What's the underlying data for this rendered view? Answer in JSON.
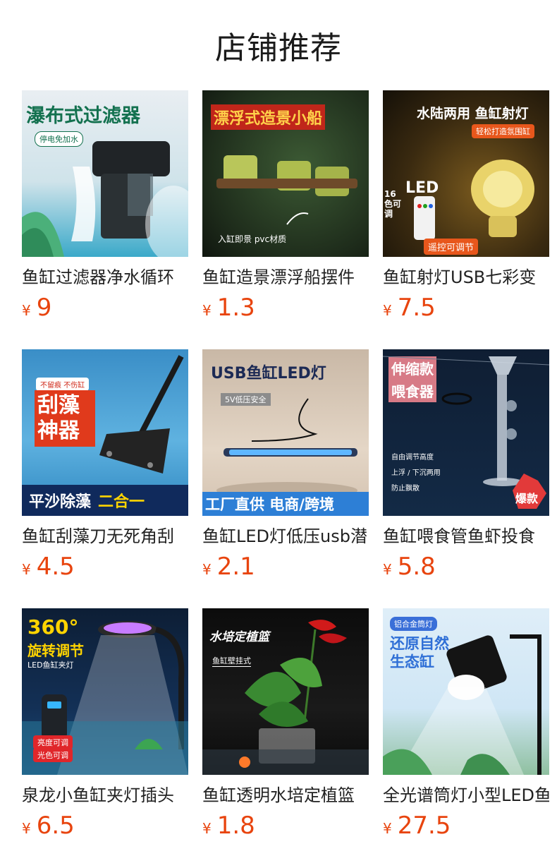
{
  "header": {
    "title": "店铺推荐"
  },
  "currency_symbol": "¥",
  "products": [
    {
      "title": "鱼缸过滤器净水循环",
      "price": "9",
      "thumb_text": {
        "main": "瀑布式过滤器",
        "badge": "停电免加水"
      }
    },
    {
      "title": "鱼缸造景漂浮船摆件",
      "price": "1.3",
      "thumb_text": {
        "main": "漂浮式造景小船",
        "sub": "入缸即景  pvc材质"
      }
    },
    {
      "title": "鱼缸射灯USB七彩变",
      "price": "7.5",
      "thumb_text": {
        "main": "水陆两用 鱼缸射灯",
        "sub": "轻松打造氛围缸",
        "badge1": "16色可调",
        "badge2": "LED",
        "badge3": "遥控可调节"
      }
    },
    {
      "title": "鱼缸刮藻刀无死角刮",
      "price": "4.5",
      "thumb_text": {
        "badge": "不留痕 不伤缸",
        "main": "刮藻神器",
        "bottom1": "平沙除藻",
        "bottom2": "二合一"
      }
    },
    {
      "title": "鱼缸LED灯低压usb潜",
      "price": "2.1",
      "thumb_text": {
        "main": "USB鱼缸LED灯",
        "sub": "5V低压安全",
        "bottom": "工厂直供 电商/跨境"
      }
    },
    {
      "title": "鱼缸喂食管鱼虾投食",
      "price": "5.8",
      "thumb_text": {
        "main1": "伸缩款",
        "main2": "喂食器",
        "f1": "自由调节高度",
        "f2": "上浮 / 下沉两用",
        "f3": "防止飘散",
        "badge": "爆款"
      }
    },
    {
      "title": "泉龙小鱼缸夹灯插头",
      "price": "6.5",
      "thumb_text": {
        "main1": "360°",
        "main2": "旋转调节",
        "sub": "LED鱼缸夹灯",
        "b1": "亮度可调",
        "b2": "光色可调"
      }
    },
    {
      "title": "鱼缸透明水培定植篮",
      "price": "1.8",
      "thumb_text": {
        "main": "水培定植篮",
        "sub": "鱼缸壁挂式"
      }
    },
    {
      "title": "全光谱筒灯小型LED鱼",
      "price": "27.5",
      "thumb_text": {
        "badge": "铝合金筒灯",
        "main1": "还原自然",
        "main2": "生态缸"
      }
    }
  ]
}
